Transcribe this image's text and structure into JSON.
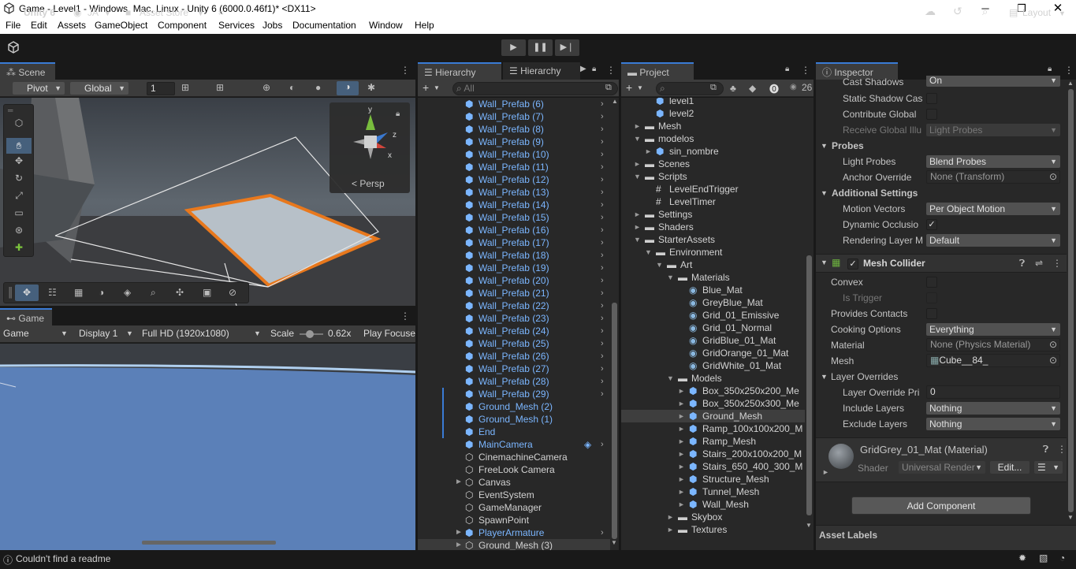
{
  "window": {
    "title": "Game - Level1 - Windows, Mac, Linux - Unity 6 (6000.0.46f1)* <DX11>"
  },
  "menu": [
    "File",
    "Edit",
    "GameObject",
    "Assets",
    "Component",
    "Services",
    "Jobs",
    "Documentation",
    "Window",
    "Help"
  ],
  "toolbar": {
    "unity": "Unity 6",
    "account": "JA",
    "asset_store": "Asset Store",
    "layout": "Layout"
  },
  "scene": {
    "tab": "Scene",
    "pivot": "Pivot",
    "global": "Global",
    "grid_value": "1",
    "persp": "Persp"
  },
  "game": {
    "tab": "Game",
    "mode": "Game",
    "display": "Display 1",
    "resolution": "Full HD (1920x1080)",
    "scale_label": "Scale",
    "scale_value": "0.62x",
    "play_focused": "Play Focuse"
  },
  "hierarchy": {
    "tab1": "Hierarchy",
    "tab2": "Hierarchy",
    "search_placeholder": "All",
    "items": [
      {
        "label": "Wall_Prefab (6)",
        "style": "blue",
        "icon": "prefab",
        "arrow": true
      },
      {
        "label": "Wall_Prefab (7)",
        "style": "blue",
        "icon": "prefab",
        "arrow": true
      },
      {
        "label": "Wall_Prefab (8)",
        "style": "blue",
        "icon": "prefab",
        "arrow": true
      },
      {
        "label": "Wall_Prefab (9)",
        "style": "blue",
        "icon": "prefab",
        "arrow": true
      },
      {
        "label": "Wall_Prefab (10)",
        "style": "blue",
        "icon": "prefab",
        "arrow": true
      },
      {
        "label": "Wall_Prefab (11)",
        "style": "blue",
        "icon": "prefab",
        "arrow": true
      },
      {
        "label": "Wall_Prefab (12)",
        "style": "blue",
        "icon": "prefab",
        "arrow": true
      },
      {
        "label": "Wall_Prefab (13)",
        "style": "blue",
        "icon": "prefab",
        "arrow": true
      },
      {
        "label": "Wall_Prefab (14)",
        "style": "blue",
        "icon": "prefab",
        "arrow": true
      },
      {
        "label": "Wall_Prefab (15)",
        "style": "blue",
        "icon": "prefab",
        "arrow": true
      },
      {
        "label": "Wall_Prefab (16)",
        "style": "blue",
        "icon": "prefab",
        "arrow": true
      },
      {
        "label": "Wall_Prefab (17)",
        "style": "blue",
        "icon": "prefab",
        "arrow": true
      },
      {
        "label": "Wall_Prefab (18)",
        "style": "blue",
        "icon": "prefab",
        "arrow": true
      },
      {
        "label": "Wall_Prefab (19)",
        "style": "blue",
        "icon": "prefab",
        "arrow": true
      },
      {
        "label": "Wall_Prefab (20)",
        "style": "blue",
        "icon": "prefab",
        "arrow": true
      },
      {
        "label": "Wall_Prefab (21)",
        "style": "blue",
        "icon": "prefab",
        "arrow": true
      },
      {
        "label": "Wall_Prefab (22)",
        "style": "blue",
        "icon": "prefab",
        "arrow": true
      },
      {
        "label": "Wall_Prefab (23)",
        "style": "blue",
        "icon": "prefab",
        "arrow": true
      },
      {
        "label": "Wall_Prefab (24)",
        "style": "blue",
        "icon": "prefab",
        "arrow": true
      },
      {
        "label": "Wall_Prefab (25)",
        "style": "blue",
        "icon": "prefab",
        "arrow": true
      },
      {
        "label": "Wall_Prefab (26)",
        "style": "blue",
        "icon": "prefab",
        "arrow": true
      },
      {
        "label": "Wall_Prefab (27)",
        "style": "blue",
        "icon": "prefab",
        "arrow": true
      },
      {
        "label": "Wall_Prefab (28)",
        "style": "blue",
        "icon": "prefab",
        "arrow": true
      },
      {
        "label": "Wall_Prefab (29)",
        "style": "blue",
        "icon": "prefab",
        "arrow": true
      },
      {
        "label": "Ground_Mesh (2)",
        "style": "blue",
        "icon": "prefab",
        "arrow": false
      },
      {
        "label": "Ground_Mesh (1)",
        "style": "blue",
        "icon": "prefab",
        "arrow": false
      },
      {
        "label": "End",
        "style": "blue",
        "icon": "prefab",
        "arrow": false
      },
      {
        "label": "MainCamera",
        "style": "blue",
        "icon": "prefab",
        "arrow": true
      },
      {
        "label": "CinemachineCamera",
        "style": "white",
        "icon": "go",
        "arrow": false
      },
      {
        "label": "FreeLook Camera",
        "style": "white",
        "icon": "go",
        "arrow": false
      },
      {
        "label": "Canvas",
        "style": "white",
        "icon": "go",
        "arrow": false
      },
      {
        "label": "EventSystem",
        "style": "white",
        "icon": "go",
        "arrow": false
      },
      {
        "label": "GameManager",
        "style": "white",
        "icon": "go",
        "arrow": false
      },
      {
        "label": "SpawnPoint",
        "style": "white",
        "icon": "go",
        "arrow": false
      },
      {
        "label": "PlayerArmature",
        "style": "blue",
        "icon": "prefab",
        "arrow": true
      },
      {
        "label": "Ground_Mesh (3)",
        "style": "white",
        "icon": "go",
        "arrow": false
      }
    ]
  },
  "project": {
    "tab": "Project",
    "count": "26",
    "items": [
      {
        "label": "level1",
        "indent": 2,
        "icon": "prefab",
        "fold": ""
      },
      {
        "label": "level2",
        "indent": 2,
        "icon": "prefab",
        "fold": ""
      },
      {
        "label": "Mesh",
        "indent": 1,
        "icon": "folder",
        "fold": "►"
      },
      {
        "label": "modelos",
        "indent": 1,
        "icon": "folder",
        "fold": "▼"
      },
      {
        "label": "sin_nombre",
        "indent": 2,
        "icon": "prefab",
        "fold": "►"
      },
      {
        "label": "Scenes",
        "indent": 1,
        "icon": "folder",
        "fold": "►"
      },
      {
        "label": "Scripts",
        "indent": 1,
        "icon": "folder",
        "fold": "▼"
      },
      {
        "label": "LevelEndTrigger",
        "indent": 2,
        "icon": "script",
        "fold": ""
      },
      {
        "label": "LevelTimer",
        "indent": 2,
        "icon": "script",
        "fold": ""
      },
      {
        "label": "Settings",
        "indent": 1,
        "icon": "folder",
        "fold": "►"
      },
      {
        "label": "Shaders",
        "indent": 1,
        "icon": "folder",
        "fold": "►"
      },
      {
        "label": "StarterAssets",
        "indent": 1,
        "icon": "folder",
        "fold": "▼"
      },
      {
        "label": "Environment",
        "indent": 2,
        "icon": "folder",
        "fold": "▼"
      },
      {
        "label": "Art",
        "indent": 3,
        "icon": "folder",
        "fold": "▼"
      },
      {
        "label": "Materials",
        "indent": 4,
        "icon": "folder",
        "fold": "▼"
      },
      {
        "label": "Blue_Mat",
        "indent": 5,
        "icon": "material",
        "fold": ""
      },
      {
        "label": "GreyBlue_Mat",
        "indent": 5,
        "icon": "material",
        "fold": ""
      },
      {
        "label": "Grid_01_Emissive",
        "indent": 5,
        "icon": "material",
        "fold": ""
      },
      {
        "label": "Grid_01_Normal",
        "indent": 5,
        "icon": "material",
        "fold": ""
      },
      {
        "label": "GridBlue_01_Mat",
        "indent": 5,
        "icon": "material",
        "fold": ""
      },
      {
        "label": "GridOrange_01_Mat",
        "indent": 5,
        "icon": "material",
        "fold": ""
      },
      {
        "label": "GridWhite_01_Mat",
        "indent": 5,
        "icon": "material",
        "fold": ""
      },
      {
        "label": "Models",
        "indent": 4,
        "icon": "folder",
        "fold": "▼"
      },
      {
        "label": "Box_350x250x200_Me",
        "indent": 5,
        "icon": "prefab",
        "fold": "►"
      },
      {
        "label": "Box_350x250x300_Me",
        "indent": 5,
        "icon": "prefab",
        "fold": "►"
      },
      {
        "label": "Ground_Mesh",
        "indent": 5,
        "icon": "prefab",
        "fold": "►",
        "selected": true
      },
      {
        "label": "Ramp_100x100x200_M",
        "indent": 5,
        "icon": "prefab",
        "fold": "►"
      },
      {
        "label": "Ramp_Mesh",
        "indent": 5,
        "icon": "prefab",
        "fold": "►"
      },
      {
        "label": "Stairs_200x100x200_M",
        "indent": 5,
        "icon": "prefab",
        "fold": "►"
      },
      {
        "label": "Stairs_650_400_300_M",
        "indent": 5,
        "icon": "prefab",
        "fold": "►"
      },
      {
        "label": "Structure_Mesh",
        "indent": 5,
        "icon": "prefab",
        "fold": "►"
      },
      {
        "label": "Tunnel_Mesh",
        "indent": 5,
        "icon": "prefab",
        "fold": "►"
      },
      {
        "label": "Wall_Mesh",
        "indent": 5,
        "icon": "prefab",
        "fold": "►"
      },
      {
        "label": "Skybox",
        "indent": 4,
        "icon": "folder",
        "fold": "►"
      },
      {
        "label": "Textures",
        "indent": 4,
        "icon": "folder",
        "fold": "►"
      }
    ]
  },
  "inspector": {
    "tab": "Inspector",
    "cast_shadows": "Cast Shadows",
    "cast_shadows_val": "On",
    "static_shadow": "Static Shadow Cas",
    "contribute_global": "Contribute Global",
    "receive_gi": "Receive Global Illu",
    "receive_gi_val": "Light Probes",
    "probes": "Probes",
    "light_probes": "Light Probes",
    "light_probes_val": "Blend Probes",
    "anchor_override": "Anchor Override",
    "anchor_override_val": "None (Transform)",
    "additional": "Additional Settings",
    "motion_vectors": "Motion Vectors",
    "motion_vectors_val": "Per Object Motion",
    "dynamic_occlusion": "Dynamic Occlusio",
    "rendering_layer": "Rendering Layer M",
    "rendering_layer_val": "Default",
    "mesh_collider": "Mesh Collider",
    "convex": "Convex",
    "is_trigger": "Is Trigger",
    "provides_contacts": "Provides Contacts",
    "cooking_options": "Cooking Options",
    "cooking_options_val": "Everything",
    "material": "Material",
    "material_val": "None (Physics Material)",
    "mesh": "Mesh",
    "mesh_val": "Cube__84_",
    "layer_overrides": "Layer Overrides",
    "layer_override_priority": "Layer Override Pri",
    "layer_override_priority_val": "0",
    "include_layers": "Include Layers",
    "include_layers_val": "Nothing",
    "exclude_layers": "Exclude Layers",
    "exclude_layers_val": "Nothing",
    "material_name": "GridGrey_01_Mat (Material)",
    "shader": "Shader",
    "shader_val": "Universal Render",
    "edit": "Edit...",
    "add_component": "Add Component",
    "asset_labels": "Asset Labels"
  },
  "status": {
    "message": "Couldn't find a readme"
  }
}
